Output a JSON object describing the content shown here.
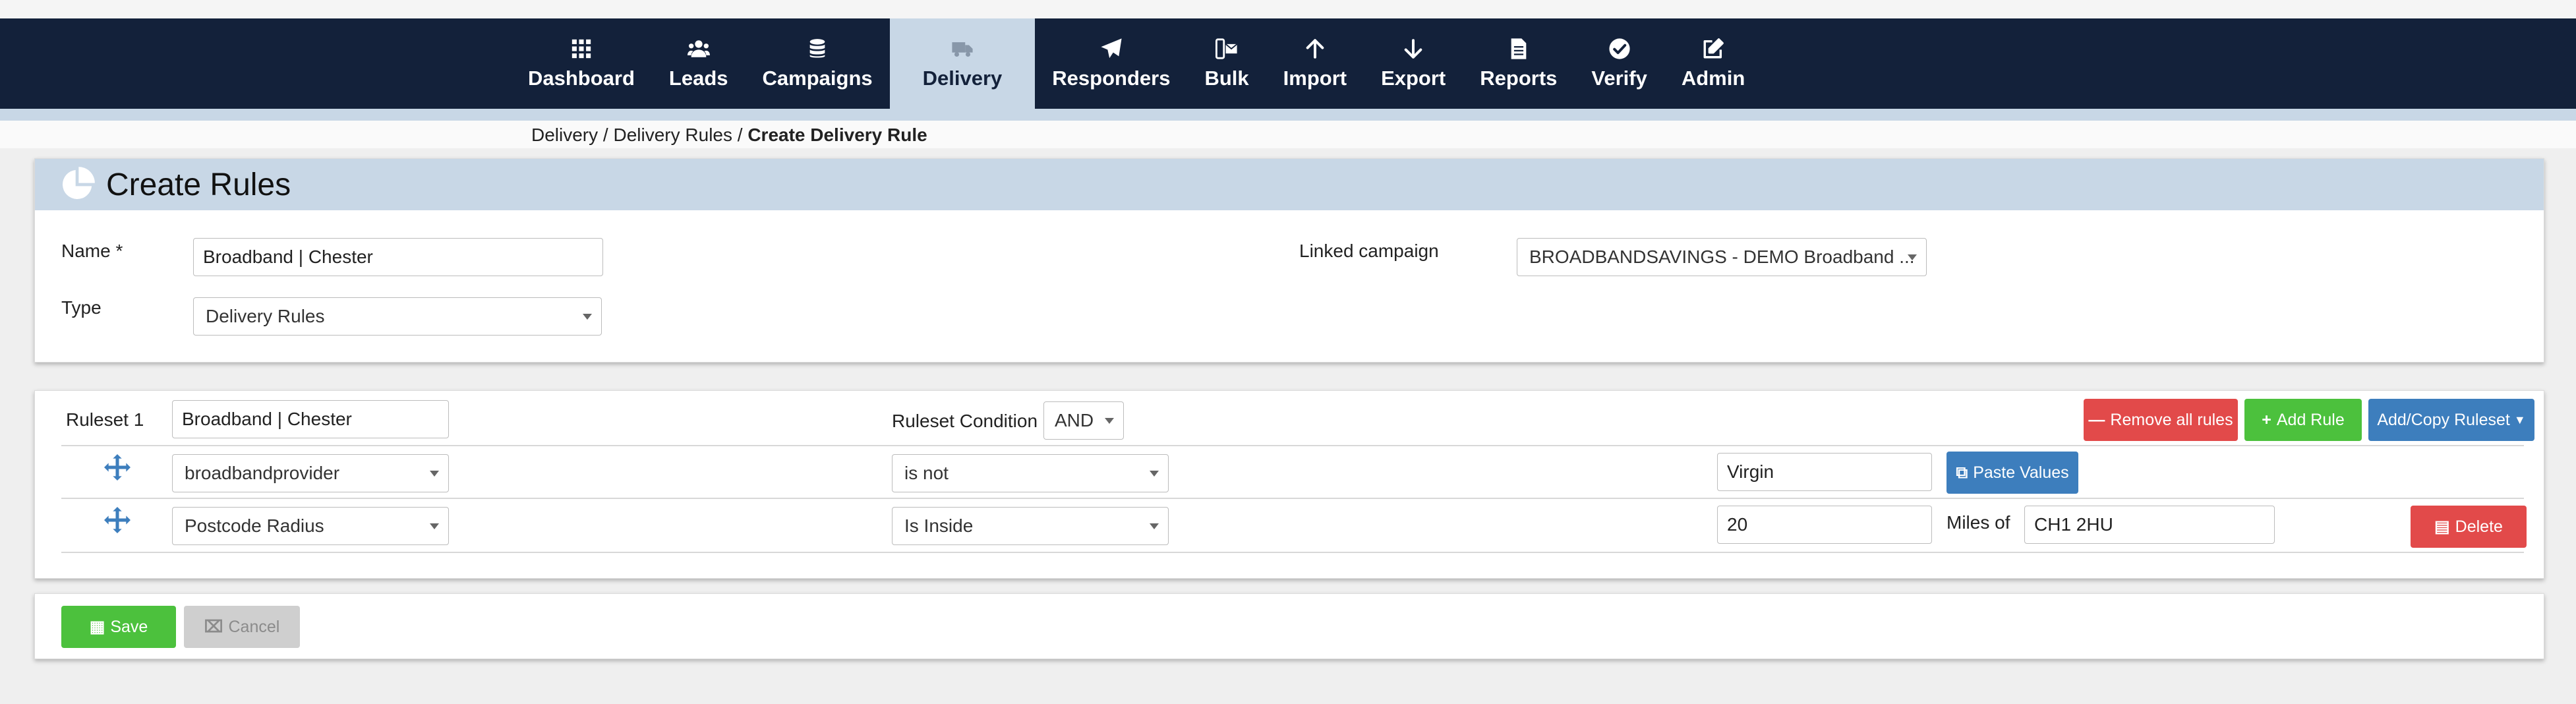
{
  "nav": {
    "items": [
      {
        "label": "Dashboard",
        "icon": "grid-icon"
      },
      {
        "label": "Leads",
        "icon": "users-icon"
      },
      {
        "label": "Campaigns",
        "icon": "database-icon"
      },
      {
        "label": "Delivery",
        "icon": "truck-icon",
        "active": true
      },
      {
        "label": "Responders",
        "icon": "paper-plane-icon"
      },
      {
        "label": "Bulk",
        "icon": "phone-envelope-icon"
      },
      {
        "label": "Import",
        "icon": "arrow-up-icon"
      },
      {
        "label": "Export",
        "icon": "arrow-down-icon"
      },
      {
        "label": "Reports",
        "icon": "document-icon"
      },
      {
        "label": "Verify",
        "icon": "check-circle-icon"
      },
      {
        "label": "Admin",
        "icon": "edit-icon"
      }
    ]
  },
  "breadcrumb": {
    "items": [
      "Delivery",
      "Delivery Rules"
    ],
    "separator": "/",
    "current": "Create Delivery Rule"
  },
  "form": {
    "title": "Create Rules",
    "name_label": "Name *",
    "name_value": "Broadband | Chester",
    "type_label": "Type",
    "type_value": "Delivery Rules",
    "linked_campaign_label": "Linked campaign",
    "linked_campaign_value": "BROADBANDSAVINGS - DEMO Broadband ..."
  },
  "ruleset": {
    "label": "Ruleset 1",
    "name_value": "Broadband | Chester",
    "condition_label": "Ruleset Condition",
    "condition_value": "AND",
    "remove_all_label": "Remove all rules",
    "add_rule_label": "Add Rule",
    "add_copy_label": "Add/Copy Ruleset",
    "rules": [
      {
        "field": "broadbandprovider",
        "operator": "is not",
        "value": "Virgin",
        "paste_label": "Paste Values"
      },
      {
        "field": "Postcode Radius",
        "operator": "Is Inside",
        "value": "20",
        "miles_label": "Miles of",
        "postcode": "CH1 2HU",
        "delete_label": "Delete"
      }
    ]
  },
  "actions": {
    "save_label": "Save",
    "cancel_label": "Cancel"
  },
  "colors": {
    "navbar": "#13213a",
    "accent_light": "#c8d7e6",
    "danger": "#e24a4a",
    "success": "#4cc13d",
    "primary": "#3d7ebd"
  }
}
